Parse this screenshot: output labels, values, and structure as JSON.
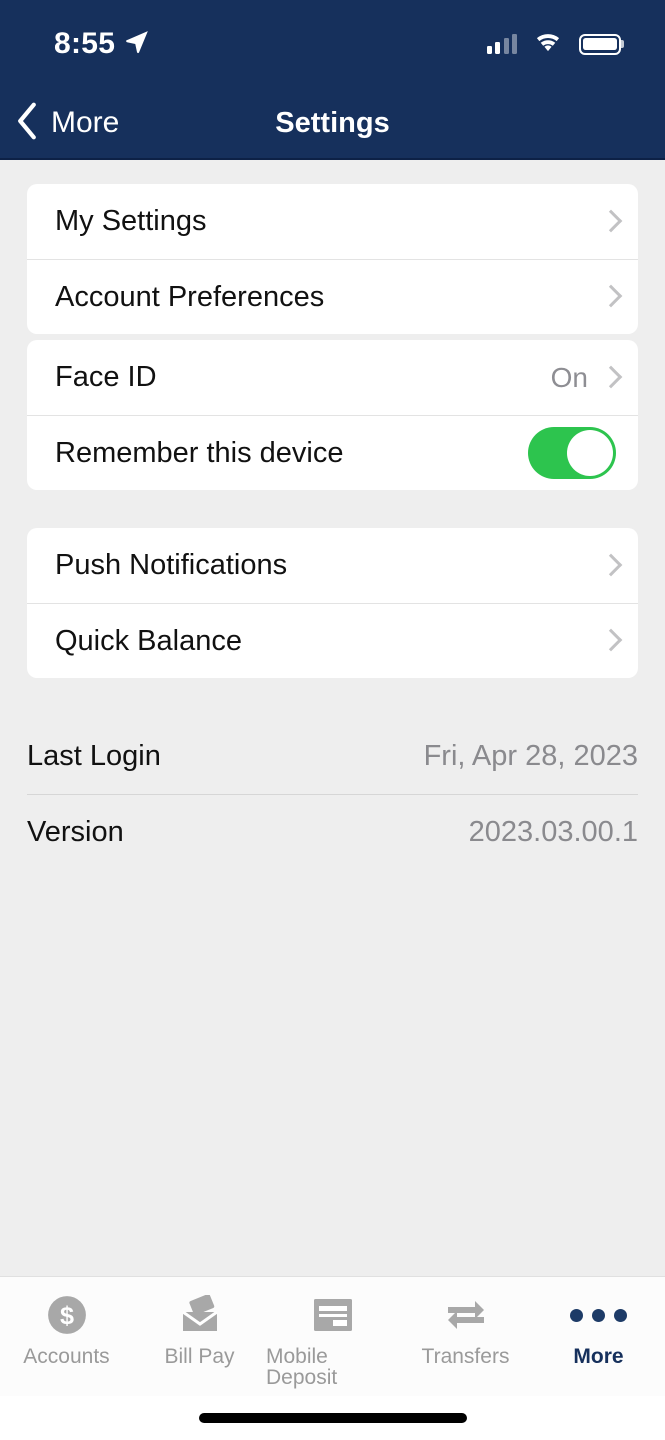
{
  "status_bar": {
    "time": "8:55",
    "location_icon": "location-arrow-icon",
    "signal_icon": "cellular-signal-icon",
    "wifi_icon": "wifi-icon",
    "battery_icon": "battery-full-icon"
  },
  "nav": {
    "back_label": "More",
    "back_icon": "chevron-left-icon",
    "title": "Settings"
  },
  "settings_groups": [
    {
      "rows": [
        {
          "label": "My Settings",
          "value": "",
          "accessory": "chevron"
        },
        {
          "label": "Account Preferences",
          "value": "",
          "accessory": "chevron"
        }
      ]
    },
    {
      "rows": [
        {
          "label": "Face ID",
          "value": "On",
          "accessory": "chevron"
        },
        {
          "label": "Remember this device",
          "value": "",
          "accessory": "toggle",
          "toggle_on": true
        }
      ]
    },
    {
      "rows": [
        {
          "label": "Push Notifications",
          "value": "",
          "accessory": "chevron"
        },
        {
          "label": "Quick Balance",
          "value": "",
          "accessory": "chevron"
        }
      ]
    }
  ],
  "info_rows": [
    {
      "label": "Last Login",
      "value": "Fri, Apr 28, 2023"
    },
    {
      "label": "Version",
      "value": "2023.03.00.1"
    }
  ],
  "tabbar": {
    "items": [
      {
        "label": "Accounts",
        "icon": "dollar-coin-icon",
        "active": false
      },
      {
        "label": "Bill Pay",
        "icon": "envelope-check-icon",
        "active": false
      },
      {
        "label": "Mobile Deposit",
        "icon": "check-deposit-icon",
        "active": false
      },
      {
        "label": "Transfers",
        "icon": "transfer-arrows-icon",
        "active": false
      },
      {
        "label": "More",
        "icon": "ellipsis-icon",
        "active": true
      }
    ]
  },
  "colors": {
    "header_navy": "#16305c",
    "page_background": "#eeeeee",
    "card_white": "#ffffff",
    "toggle_green": "#2dc44e",
    "muted_gray": "#8e8e93",
    "accent_navy": "#16305c"
  }
}
